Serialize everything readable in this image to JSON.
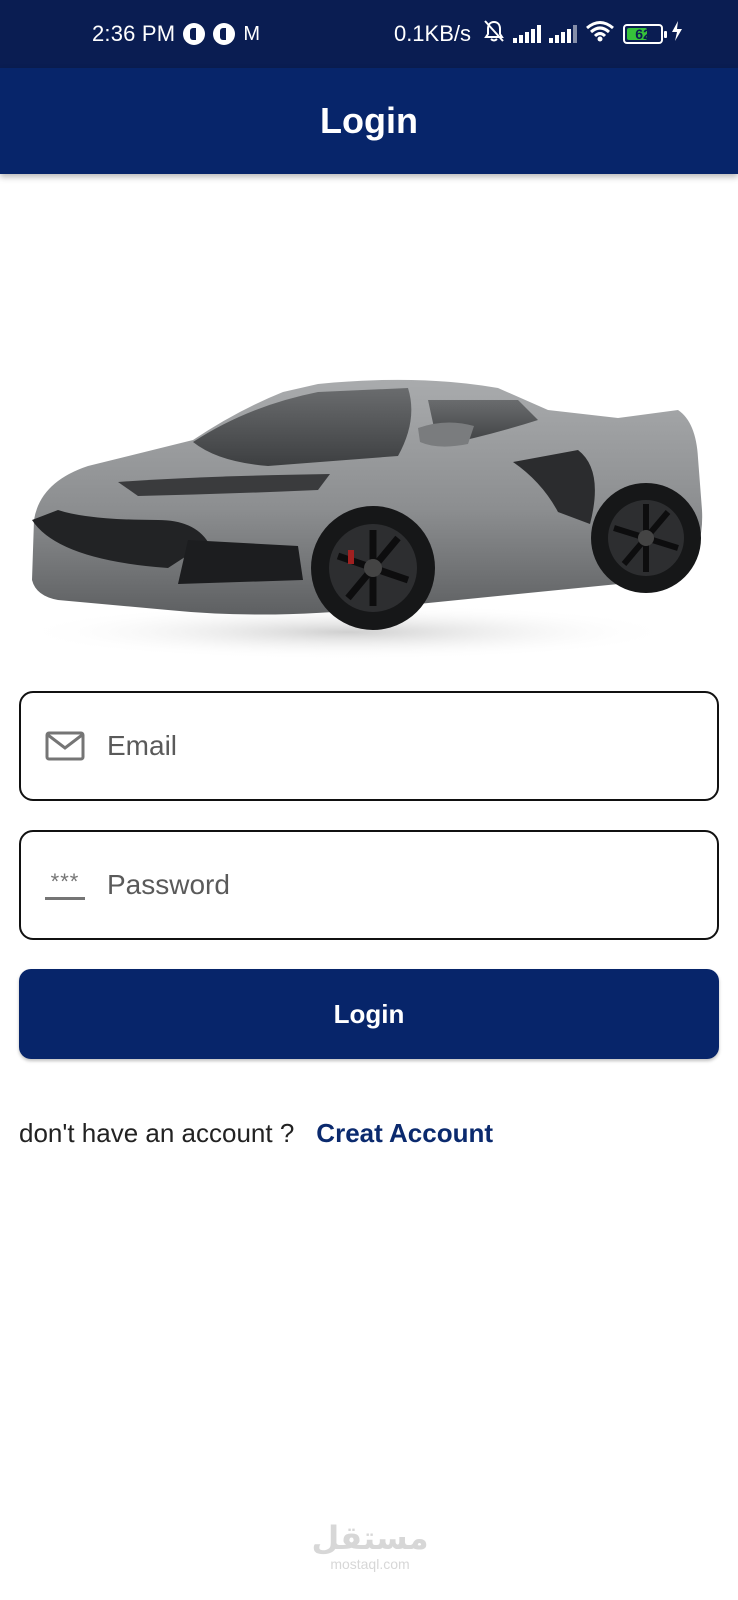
{
  "status_bar": {
    "time": "2:36 PM",
    "mail_icon_letter": "M",
    "net_speed": "0.1KB/s",
    "battery_level": "62",
    "battery_percent": 62,
    "battery_color": "#37c23a"
  },
  "app_bar": {
    "title": "Login"
  },
  "form": {
    "email": {
      "placeholder": "Email",
      "value": ""
    },
    "password": {
      "placeholder": "Password",
      "value": "",
      "icon_text": "***"
    },
    "login_button": "Login"
  },
  "signup": {
    "prompt": "don't have an account ?",
    "link": "Creat Account"
  },
  "watermark": {
    "logo": "مستقل",
    "text": "mostaql.com"
  },
  "colors": {
    "primary": "#07256a",
    "status_bar": "#0a1d52",
    "link": "#0b2a6e"
  },
  "icons": [
    "email-icon",
    "password-icon",
    "wifi-icon",
    "signal-icon",
    "battery-icon",
    "charging-icon",
    "mute-bell-icon"
  ]
}
